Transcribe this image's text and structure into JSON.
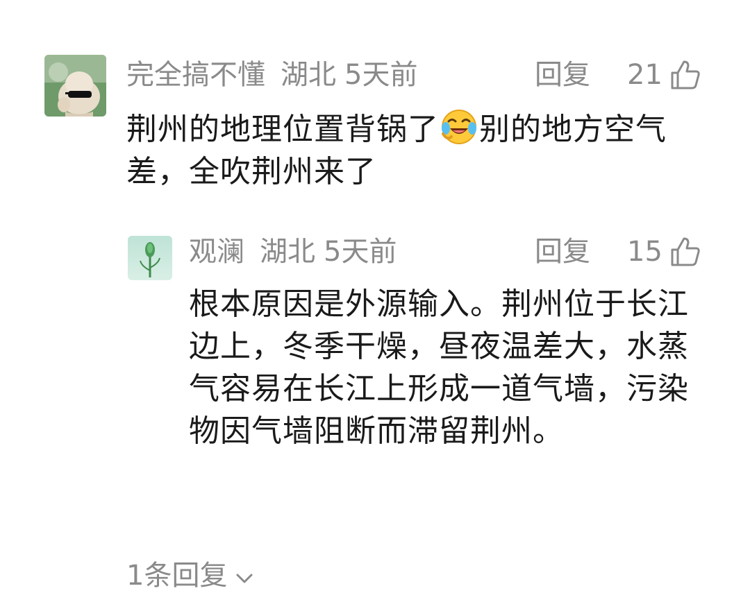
{
  "comments": [
    {
      "username": "完全搞不懂",
      "location": "湖北",
      "time": "5天前",
      "reply_label": "回复",
      "likes": "21",
      "text_before_emoji": "荆州的地理位置背锅了",
      "emoji": "laughing-crying-face",
      "text_after_emoji": "别的地方空气差，全吹荆州来了",
      "avatar": "cat-with-sunglasses"
    }
  ],
  "replies": [
    {
      "username": "观澜",
      "location": "湖北",
      "time": "5天前",
      "reply_label": "回复",
      "likes": "15",
      "text": "根本原因是外源输入。荆州位于长江边上，冬季干燥，昼夜温差大，水蒸气容易在长江上形成一道气墙，污染物因气墙阻断而滞留荆州。",
      "avatar": "green-flower-bud"
    }
  ],
  "more_replies": {
    "label": "1条回复",
    "icon": "chevron-down-icon"
  },
  "colors": {
    "meta_gray": "#8a8a8a",
    "text": "#1a1a1a",
    "background": "#ffffff"
  }
}
